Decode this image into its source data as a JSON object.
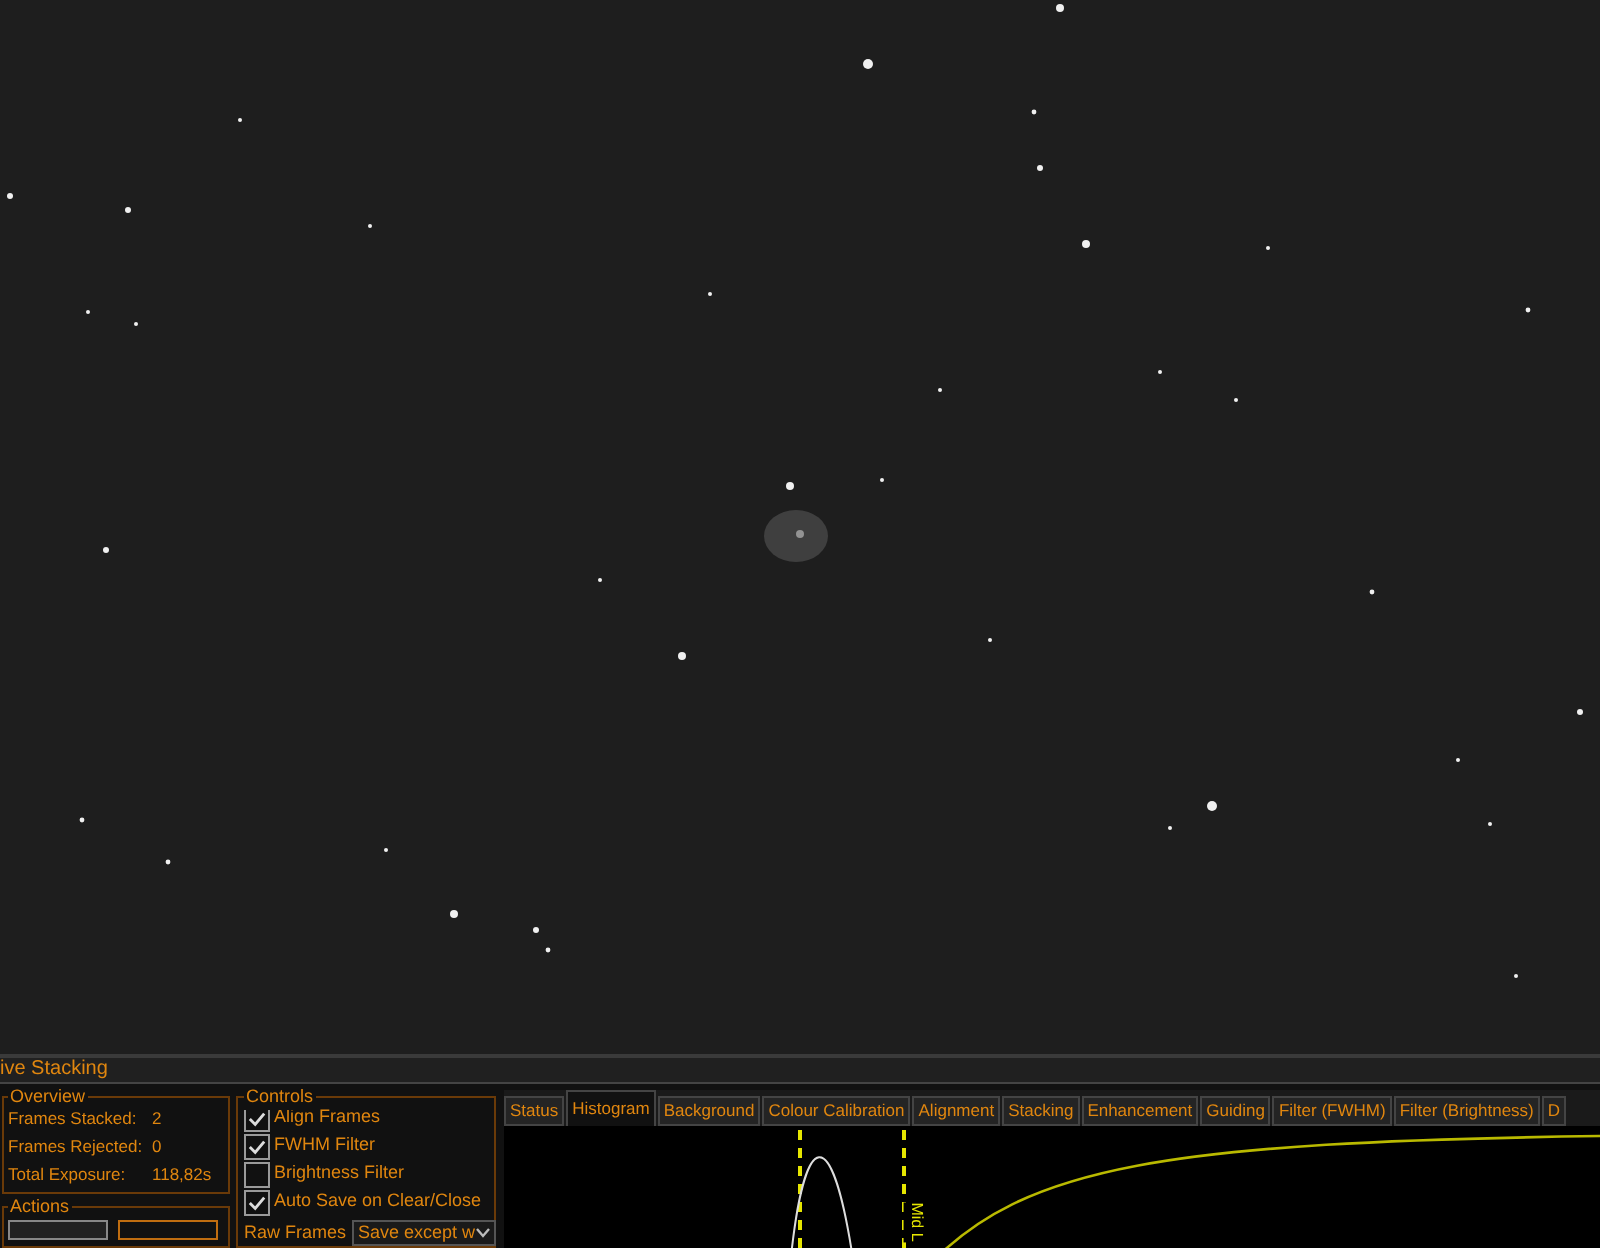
{
  "panel_title": "ive Stacking",
  "overview": {
    "title": "Overview",
    "rows": [
      {
        "label": "Frames Stacked:",
        "value": "2"
      },
      {
        "label": "Frames Rejected:",
        "value": "0"
      },
      {
        "label": "Total Exposure:",
        "value": "118,82s"
      }
    ]
  },
  "actions": {
    "title": "Actions"
  },
  "controls": {
    "title": "Controls",
    "options": [
      {
        "label": "Align Frames",
        "checked": true
      },
      {
        "label": "FWHM Filter",
        "checked": true
      },
      {
        "label": "Brightness Filter",
        "checked": false
      },
      {
        "label": "Auto Save on Clear/Close",
        "checked": true
      }
    ],
    "raw_frames": {
      "label": "Raw Frames",
      "value": "Save except w"
    }
  },
  "tabs": [
    {
      "label": "Status",
      "selected": false
    },
    {
      "label": "Histogram",
      "selected": true
    },
    {
      "label": "Background",
      "selected": false
    },
    {
      "label": "Colour Calibration",
      "selected": false
    },
    {
      "label": "Alignment",
      "selected": false
    },
    {
      "label": "Stacking",
      "selected": false
    },
    {
      "label": "Enhancement",
      "selected": false
    },
    {
      "label": "Guiding",
      "selected": false
    },
    {
      "label": "Filter (FWHM)",
      "selected": false
    },
    {
      "label": "Filter (Brightness)",
      "selected": false
    },
    {
      "label": "D",
      "selected": false
    }
  ],
  "histogram": {
    "marker_label": "Mid L"
  }
}
